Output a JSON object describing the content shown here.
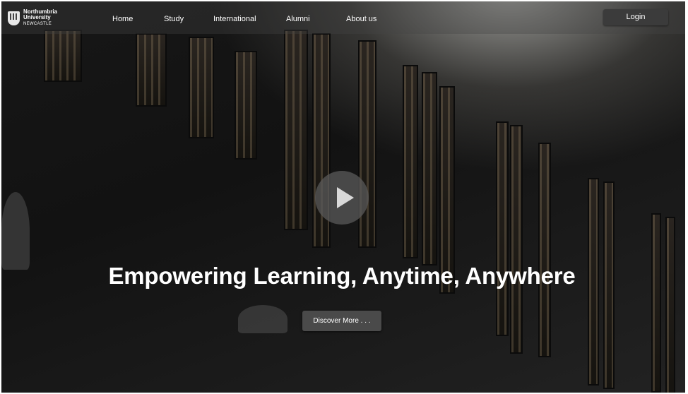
{
  "brand": {
    "name_line1": "Northumbria",
    "name_line2": "University",
    "name_line3": "NEWCASTLE"
  },
  "nav": {
    "items": [
      {
        "label": "Home"
      },
      {
        "label": "Study"
      },
      {
        "label": "International"
      },
      {
        "label": "Alumni"
      },
      {
        "label": "About us"
      }
    ],
    "login_label": "Login"
  },
  "hero": {
    "headline": "Empowering Learning, Anytime, Anywhere",
    "cta_label": "Discover More . . .",
    "play_icon": "play-icon"
  },
  "colors": {
    "overlay": "#171717",
    "button": "#3b3b3b",
    "text": "#ffffff"
  }
}
